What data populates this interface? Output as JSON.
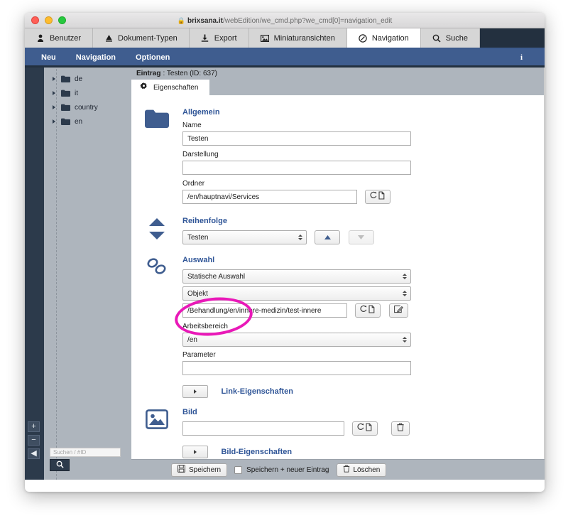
{
  "browser": {
    "url_lock_icon": "lock-icon",
    "url_host": "brixsana.it",
    "url_path": "/webEdition/we_cmd.php?we_cmd[0]=navigation_edit"
  },
  "tabs": [
    {
      "label": "Benutzer",
      "icon": "user-icon",
      "active": false
    },
    {
      "label": "Dokument-Typen",
      "icon": "document-type-icon",
      "active": false
    },
    {
      "label": "Export",
      "icon": "export-icon",
      "active": false
    },
    {
      "label": "Miniaturansichten",
      "icon": "thumbnails-icon",
      "active": false
    },
    {
      "label": "Navigation",
      "icon": "navigation-icon",
      "active": true
    },
    {
      "label": "Suche",
      "icon": "search-icon",
      "active": false
    }
  ],
  "menubar": {
    "items": [
      "Neu",
      "Navigation",
      "Optionen"
    ],
    "info_label": "i"
  },
  "sidebar": {
    "tree": [
      {
        "label": "de"
      },
      {
        "label": "it"
      },
      {
        "label": "country"
      },
      {
        "label": "en"
      }
    ],
    "search": {
      "placeholder": "Suchen / #ID",
      "value": ""
    },
    "search_button_icon": "magnifier-icon",
    "rail_buttons": [
      {
        "icon": "plus-icon",
        "label": "+"
      },
      {
        "icon": "minus-icon",
        "label": "−"
      },
      {
        "icon": "collapse-left-icon",
        "label": "◀"
      }
    ]
  },
  "content": {
    "entry_prefix": "Eintrag",
    "entry_title": ": Testen (ID: 637)",
    "subtab": {
      "label": "Eigenschaften",
      "icon": "gear-icon"
    }
  },
  "sections": {
    "allgemein": {
      "icon": "folder-icon",
      "title": "Allgemein",
      "name_label": "Name",
      "name_value": "Testen",
      "darstellung_label": "Darstellung",
      "darstellung_value": "",
      "ordner_label": "Ordner",
      "ordner_value": "/en/hauptnavi/Services",
      "browse_icon": "browse-document-icon"
    },
    "reihenfolge": {
      "icon": "sort-updown-icon",
      "title": "Reihenfolge",
      "select_value": "Testen",
      "up_icon": "arrow-up-icon",
      "down_icon": "arrow-down-icon"
    },
    "auswahl": {
      "icon": "link-chain-icon",
      "title": "Auswahl",
      "type_value": "Statische Auswahl",
      "target_value": "Objekt",
      "path_value": "/Behandlung/en/innere-medizin/test-innere",
      "browse_icon": "browse-document-icon",
      "edit_icon": "edit-pencil-icon",
      "arbeitsbereich_label": "Arbeitsbereich",
      "arbeitsbereich_value": "/en",
      "parameter_label": "Parameter",
      "parameter_value": ""
    },
    "link_eigenschaften": {
      "expander_icon": "expand-right-icon",
      "label": "Link-Eigenschaften"
    },
    "bild": {
      "icon": "image-icon",
      "title": "Bild",
      "value": "",
      "browse_icon": "browse-document-icon",
      "delete_icon": "trash-icon"
    },
    "bild_eigenschaften": {
      "expander_icon": "expand-right-icon",
      "label": "Bild-Eigenschaften"
    }
  },
  "footer": {
    "save_label": "Speichern",
    "save_icon": "save-disk-icon",
    "save_new_label": "Speichern + neuer Eintrag",
    "delete_label": "Löschen",
    "delete_icon": "trash-icon"
  },
  "annotation": {
    "shape": "ellipse",
    "color": "#e919b8",
    "targets": [
      "Arbeitsbereich",
      "/en"
    ]
  },
  "colors": {
    "accent_blue": "#2f5597",
    "menubar_blue": "#3f5d8f",
    "dark_navy": "#23303f",
    "panel_grey": "#aeb5bd",
    "annotation_magenta": "#e919b8"
  }
}
